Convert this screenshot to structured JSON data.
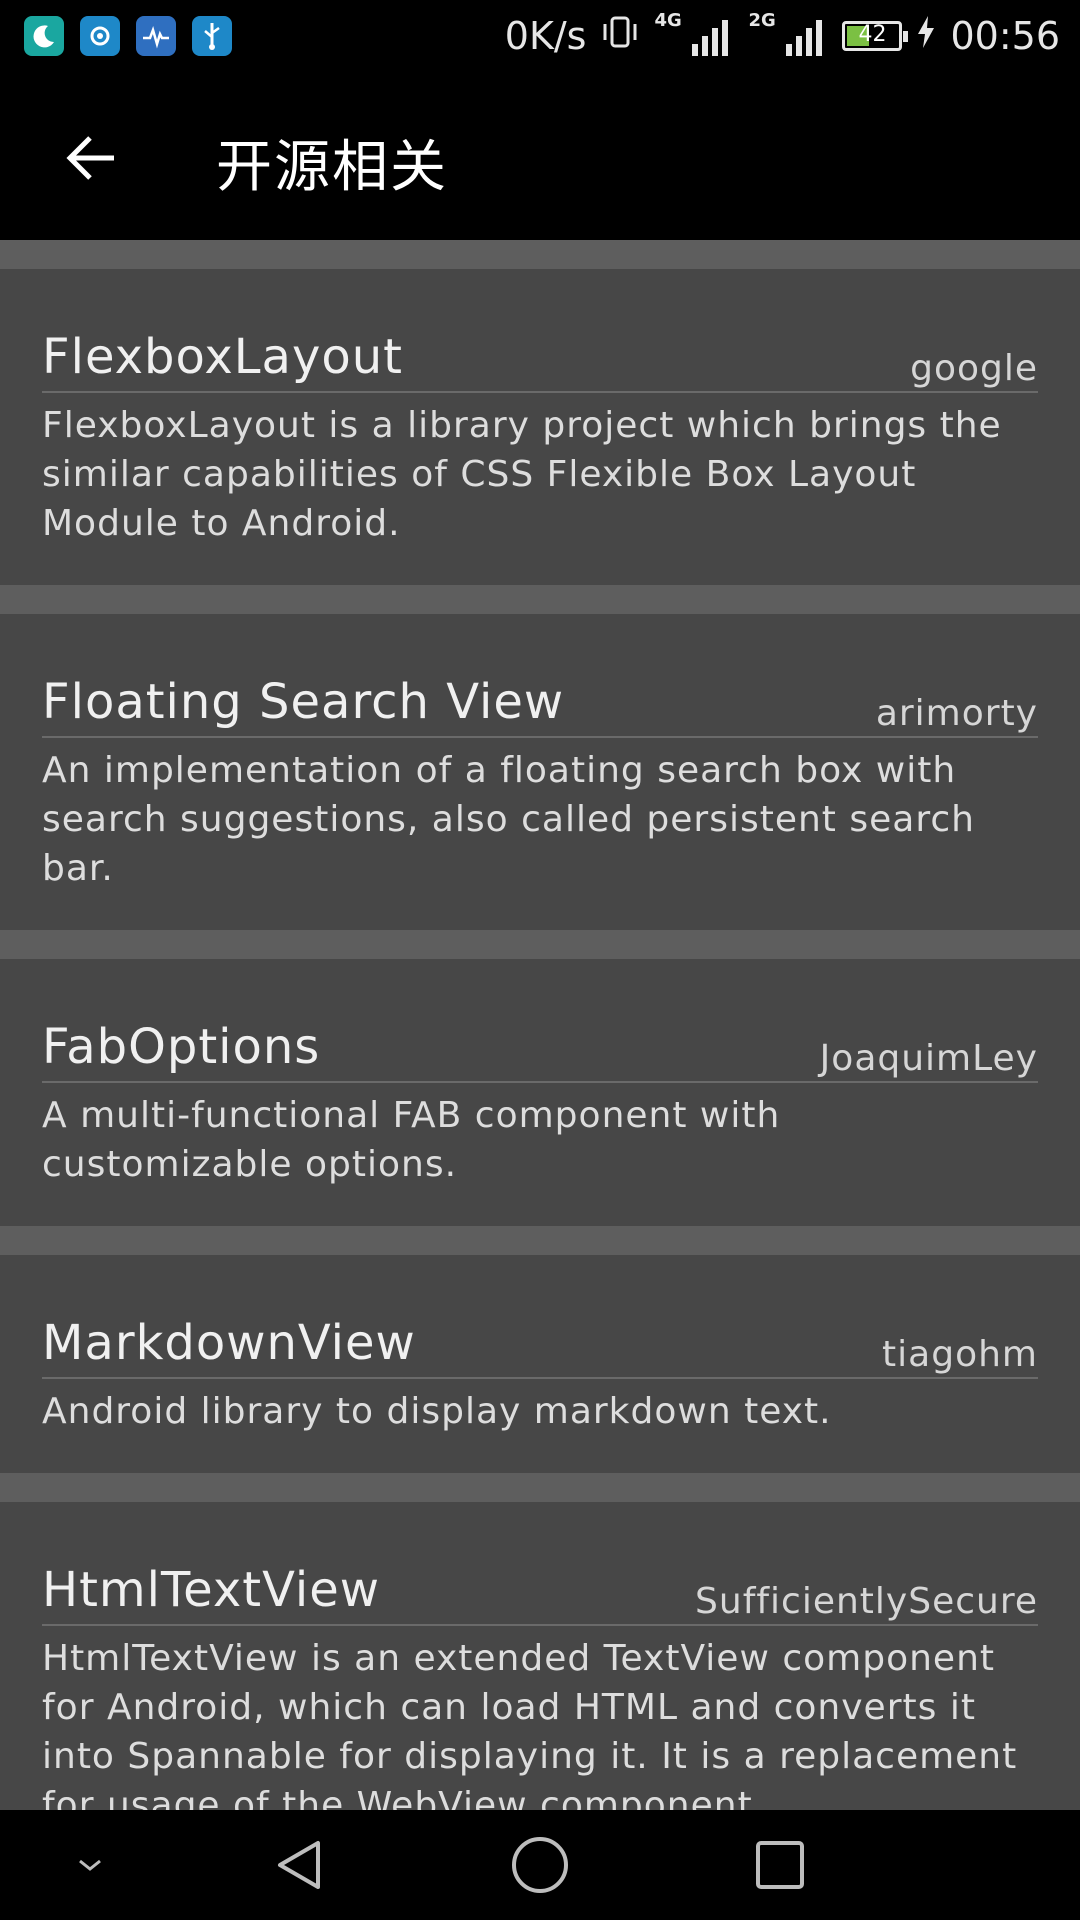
{
  "status_bar": {
    "app_icons": [
      "moon-app-icon",
      "sync-app-icon",
      "health-app-icon",
      "usb-icon"
    ],
    "net_speed": "0K/s",
    "signal1_label": "4G",
    "signal2_label": "2G",
    "battery_level": "42",
    "time": "00:56"
  },
  "app_bar": {
    "back_icon": "arrow-left-icon",
    "title": "开源相关"
  },
  "items": [
    {
      "name": "FlexboxLayout",
      "author": "google",
      "description": "FlexboxLayout is a library project which brings the similar capabilities of CSS Flexible Box Layout Module to Android."
    },
    {
      "name": "Floating Search View",
      "author": "arimorty",
      "description": "An implementation of a floating search box with search suggestions, also called persistent search bar."
    },
    {
      "name": "FabOptions",
      "author": "JoaquimLey",
      "description": "A multi-functional FAB component with customizable options."
    },
    {
      "name": "MarkdownView",
      "author": "tiagohm",
      "description": "Android library to display markdown text."
    },
    {
      "name": "HtmlTextView",
      "author": "SufficientlySecure",
      "description": "HtmlTextView is an extended TextView component for Android, which can load HTML and converts it into Spannable for displaying it. It is a replacement for usage of the WebView component."
    }
  ],
  "nav_bar": {
    "buttons": [
      "chevron-down-icon",
      "back-triangle-icon",
      "home-circle-icon",
      "recents-square-icon"
    ]
  }
}
